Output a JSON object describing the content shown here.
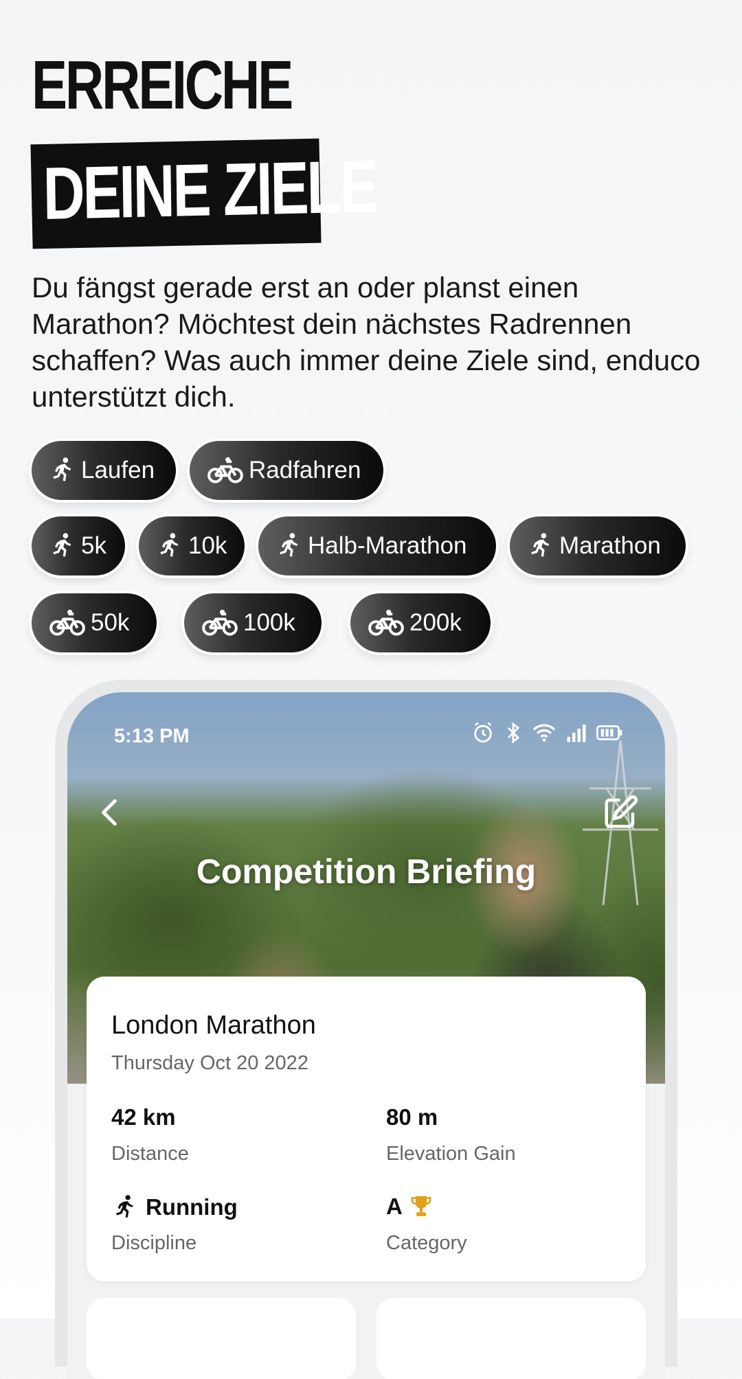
{
  "headline": {
    "line1": "ERREICHE",
    "line2": "DEINE ZIELE"
  },
  "intro_text": "Du fängst gerade erst an oder planst einen Marathon? Möchtest dein nächstes Radrennen schaffen? Was auch immer deine Ziele sind, enduco unterstützt dich.",
  "sports": [
    {
      "label": "Laufen",
      "icon": "runner-icon"
    },
    {
      "label": "Radfahren",
      "icon": "bike-icon"
    }
  ],
  "run_distances": [
    {
      "label": "5k",
      "icon": "runner-icon"
    },
    {
      "label": "10k",
      "icon": "runner-icon"
    },
    {
      "label": "Halb-Marathon",
      "icon": "runner-icon"
    },
    {
      "label": "Marathon",
      "icon": "runner-icon"
    }
  ],
  "bike_distances": [
    {
      "label": "50k",
      "icon": "bike-icon"
    },
    {
      "label": "100k",
      "icon": "bike-icon"
    },
    {
      "label": "200k",
      "icon": "bike-icon"
    }
  ],
  "phone": {
    "status_time": "5:13 PM",
    "status_icons": [
      "alarm-icon",
      "bluetooth-icon",
      "wifi-icon",
      "signal-icon",
      "battery-icon"
    ],
    "screen_title": "Competition Briefing",
    "event": {
      "name": "London Marathon",
      "date": "Thursday Oct 20 2022",
      "distance_value": "42 km",
      "distance_label": "Distance",
      "elevation_value": "80 m",
      "elevation_label": "Elevation Gain",
      "discipline_value": "Running",
      "discipline_label": "Discipline",
      "category_value": "A",
      "category_label": "Category",
      "category_icon": "trophy-icon"
    }
  }
}
